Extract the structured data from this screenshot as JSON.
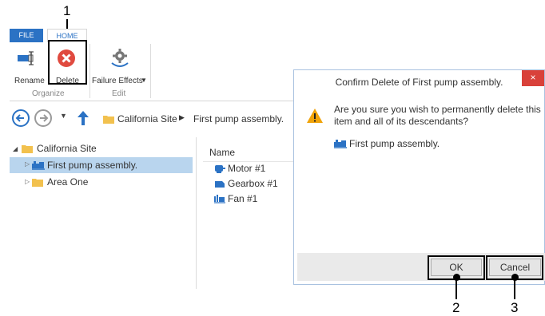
{
  "annotations": {
    "c1": "1",
    "c2": "2",
    "c3": "3"
  },
  "tabs": {
    "file": "FILE",
    "home": "HOME"
  },
  "ribbon": {
    "rename": "Rename",
    "delete": "Delete",
    "failure_effects": "Failure Effects",
    "group_organize": "Organize",
    "group_edit": "Edit"
  },
  "breadcrumb": {
    "root": "California Site",
    "current": "First pump assembly."
  },
  "tree": {
    "root": "California Site",
    "selected": "First pump assembly.",
    "other": "Area One"
  },
  "list": {
    "column_name": "Name",
    "items": [
      "Motor #1",
      "Gearbox #1",
      "Fan #1"
    ]
  },
  "dialog": {
    "title": "Confirm Delete of First pump assembly.",
    "close": "×",
    "message": "Are you sure you wish to permanently delete this item and all of its descendants?",
    "message_line1": "Are you sure you wish to permanently delete this",
    "message_line2": "item and all of its descendants?",
    "item": "First pump assembly.",
    "ok": "OK",
    "cancel": "Cancel"
  },
  "colors": {
    "accent": "#2b72c4",
    "selected_row": "#b9d5ee",
    "close_red": "#d9413a",
    "delete_red": "#e04a3f",
    "warning": "#f0a30a"
  }
}
